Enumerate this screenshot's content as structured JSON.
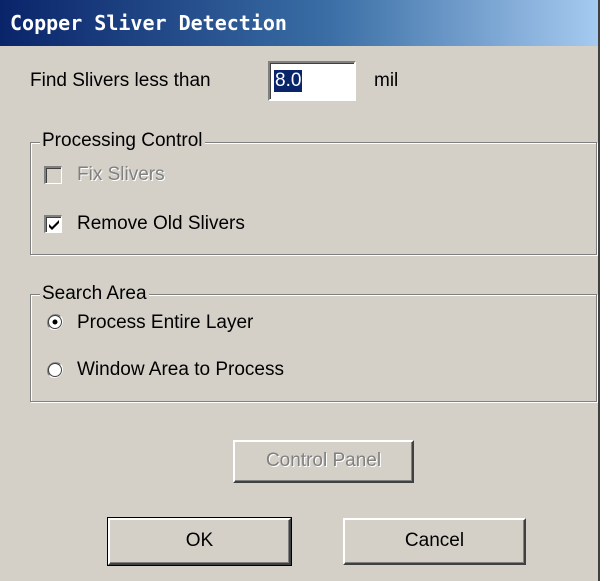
{
  "window": {
    "title": "Copper Sliver Detection"
  },
  "threshold": {
    "label": "Find Slivers less than",
    "value": "8.0",
    "unit": "mil"
  },
  "processing_control": {
    "title": "Processing Control",
    "fix_slivers": {
      "label": "Fix Slivers",
      "checked": false,
      "enabled": false
    },
    "remove_old_slivers": {
      "label": "Remove Old Slivers",
      "checked": true,
      "enabled": true
    }
  },
  "search_area": {
    "title": "Search Area",
    "options": [
      {
        "label": "Process Entire Layer",
        "selected": true
      },
      {
        "label": "Window Area to Process",
        "selected": false
      }
    ]
  },
  "buttons": {
    "control_panel": "Control Panel",
    "ok": "OK",
    "cancel": "Cancel"
  },
  "colors": {
    "title_bar_start": "#0a246a",
    "title_bar_end": "#a6caf0",
    "dialog_face": "#d4d0c8",
    "selection": "#0a246a"
  }
}
